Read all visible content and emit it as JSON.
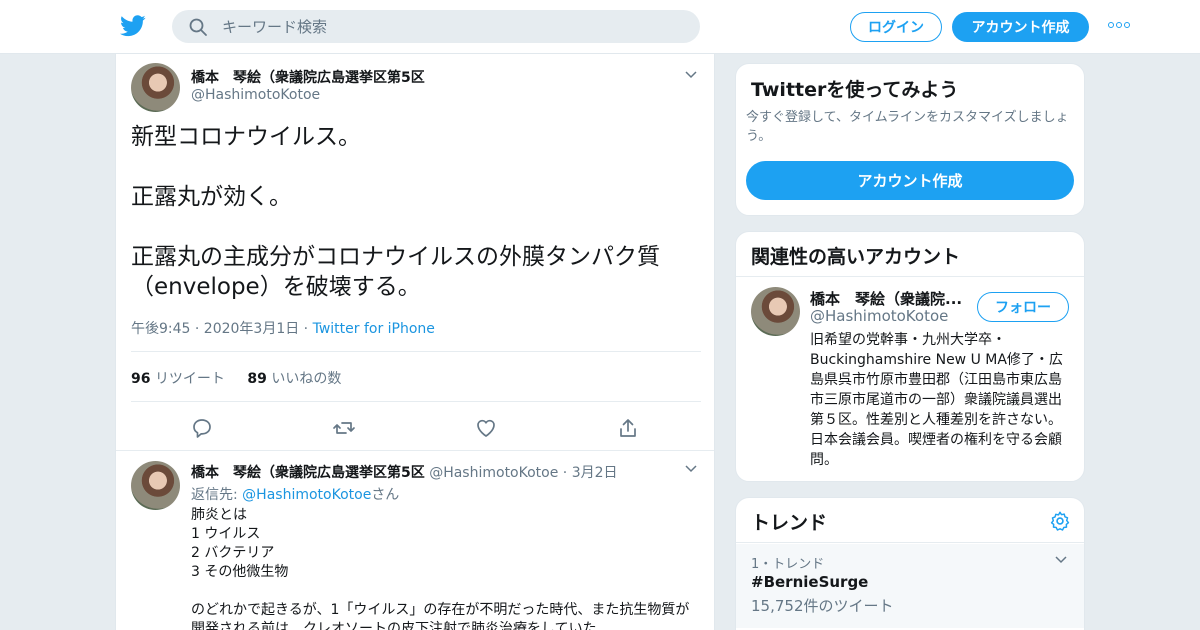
{
  "header": {
    "search_placeholder": "キーワード検索",
    "login_label": "ログイン",
    "signup_label": "アカウント作成"
  },
  "tweet": {
    "user_name": "橋本　琴絵（衆議院広島選挙区第5区",
    "user_handle": "@HashimotoKotoe",
    "text_line1": "新型コロナウイルス。",
    "text_line2": "正露丸が効く。",
    "text_line3": "正露丸の主成分がコロナウイルスの外膜タンパク質（envelope）を破壊する。",
    "timestamp": "午後9:45 · 2020年3月1日 · ",
    "source": "Twitter for iPhone",
    "retweet_count": "96",
    "retweet_label": "リツイート",
    "like_count": "89",
    "like_label": "いいねの数"
  },
  "reply": {
    "user_name": "橋本　琴絵（衆議院広島選挙区第5区",
    "user_handle": "@HashimotoKotoe",
    "date": "· 3月2日",
    "reply_to_prefix": "返信先: ",
    "reply_to_handle": "@HashimotoKotoe",
    "reply_to_suffix": "さん",
    "lines": [
      "肺炎とは",
      "1 ウイルス",
      "2 バクテリア",
      "3 その他微生物",
      "",
      "のどれかで起きるが、1「ウイルス」の存在が不明だった時代、また抗生物質が開発される前は、クレオソートの皮下注射で肺炎治療をしていた"
    ]
  },
  "sidebar": {
    "try_title": "Twitterを使ってみよう",
    "try_subtitle": "今すぐ登録して、タイムラインをカスタマイズしましょう。",
    "try_button": "アカウント作成",
    "related_title": "関連性の高いアカウント",
    "related_name": "橋本　琴絵（衆議院...",
    "related_handle": "@HashimotoKotoe",
    "follow_label": "フォロー",
    "related_bio": "旧希望の党幹事・九州大学卒・Buckinghamshire New U MA修了・広島県呉市竹原市豊田郡（江田島市東広島市三原市尾道市の一部）衆議院議員選出第５区。性差別と人種差別を許さない。日本会議会員。喫煙者の権利を守る会顧問。",
    "trends_title": "トレンド",
    "trend_meta": "1・トレンド",
    "trend_name": "#BernieSurge",
    "trend_count": "15,752件のツイート"
  },
  "colors": {
    "accent": "#1da1f2",
    "link": "#1b95e0",
    "muted": "#657786",
    "bg": "#e6ecf0"
  }
}
